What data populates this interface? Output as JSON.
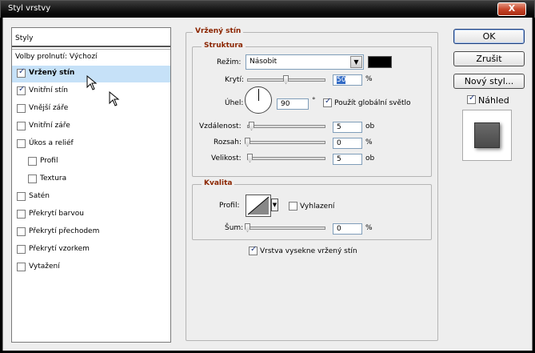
{
  "window": {
    "title": "Styl vrstvy",
    "close_glyph": "X"
  },
  "left_panel": {
    "header": "Styly",
    "blend_options": "Volby prolnutí: Výchozí",
    "items": [
      {
        "label": "Vržený stín",
        "checked": true,
        "selected": true
      },
      {
        "label": "Vnitřní stín",
        "checked": true
      },
      {
        "label": "Vnější záře",
        "checked": false
      },
      {
        "label": "Vnitřní záře",
        "checked": false
      },
      {
        "label": "Úkos a reliéf",
        "checked": false
      },
      {
        "label": "Profil",
        "checked": false,
        "sub": true
      },
      {
        "label": "Textura",
        "checked": false,
        "sub": true
      },
      {
        "label": "Satén",
        "checked": false
      },
      {
        "label": "Překrytí barvou",
        "checked": false
      },
      {
        "label": "Překrytí přechodem",
        "checked": false
      },
      {
        "label": "Překrytí vzorkem",
        "checked": false
      },
      {
        "label": "Vytažení",
        "checked": false
      }
    ]
  },
  "drop_shadow": {
    "title": "Vržený stín",
    "structure": {
      "title": "Struktura",
      "mode_label": "Režim:",
      "mode_value": "Násobit",
      "color": "#000000",
      "opacity_label": "Krytí:",
      "opacity_value": "50",
      "opacity_unit": "%",
      "opacity_level": 0.5,
      "angle_label": "Úhel:",
      "angle_value": "90",
      "angle_unit": "°",
      "global_light_label": "Použít globální světlo",
      "global_light_checked": true,
      "distance_label": "Vzdálenost:",
      "distance_value": "5",
      "distance_unit": "ob",
      "spread_label": "Rozsah:",
      "spread_value": "0",
      "spread_unit": "%",
      "size_label": "Velikost:",
      "size_value": "5",
      "size_unit": "ob"
    },
    "quality": {
      "title": "Kvalita",
      "contour_label": "Profil:",
      "antialias_label": "Vyhlazení",
      "antialias_checked": false,
      "noise_label": "Šum:",
      "noise_value": "0",
      "noise_unit": "%"
    },
    "knockout_label": "Vrstva vysekne vržený stín",
    "knockout_checked": true
  },
  "buttons": {
    "ok": "OK",
    "reset": "Zrušit",
    "new_style": "Nový styl...",
    "preview_label": "Náhled",
    "preview_checked": true
  }
}
